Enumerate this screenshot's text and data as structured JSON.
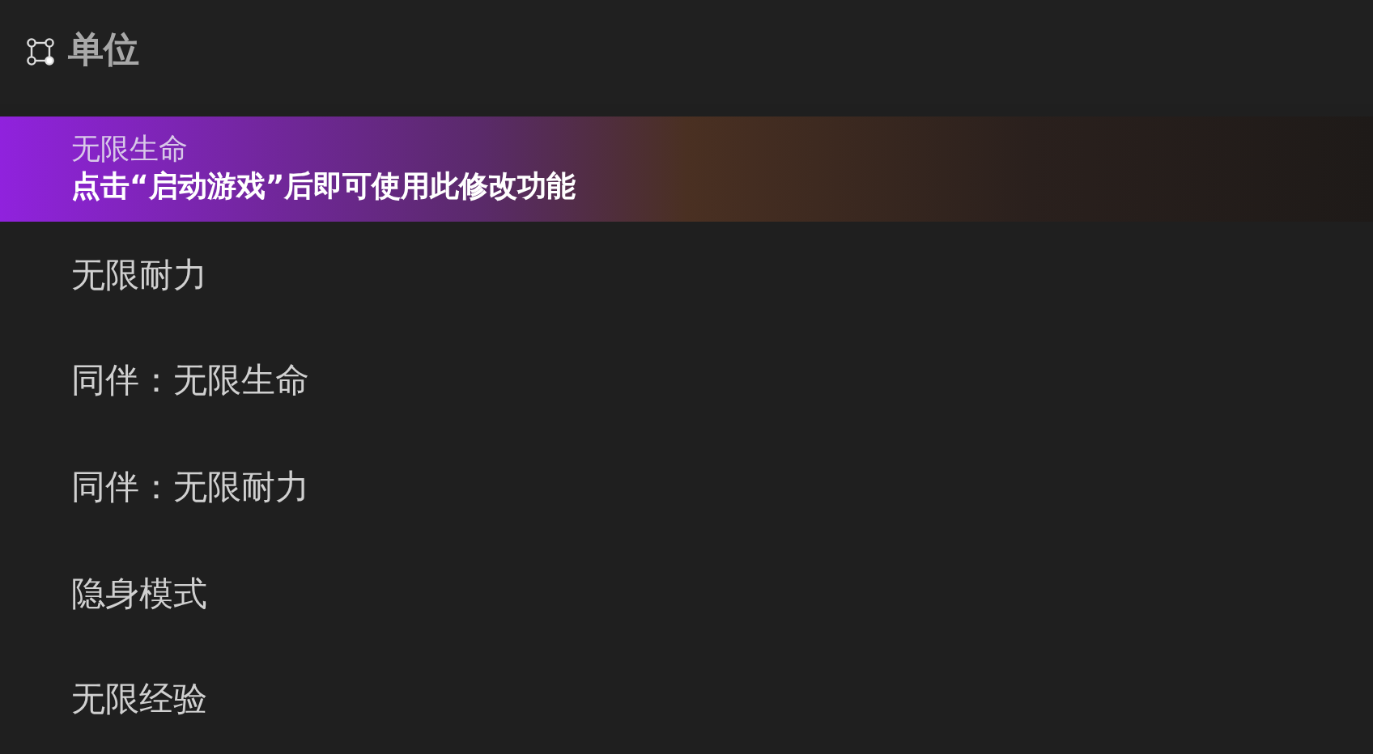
{
  "section": {
    "title": "单位"
  },
  "items": [
    {
      "label": "无限生命",
      "hint": "点击“启动游戏”后即可使用此修改功能",
      "selected": true
    },
    {
      "label": "无限耐力",
      "selected": false
    },
    {
      "label": "同伴：无限生命",
      "selected": false
    },
    {
      "label": "同伴：无限耐力",
      "selected": false
    },
    {
      "label": "隐身模式",
      "selected": false
    },
    {
      "label": "无限经验",
      "selected": false
    }
  ]
}
